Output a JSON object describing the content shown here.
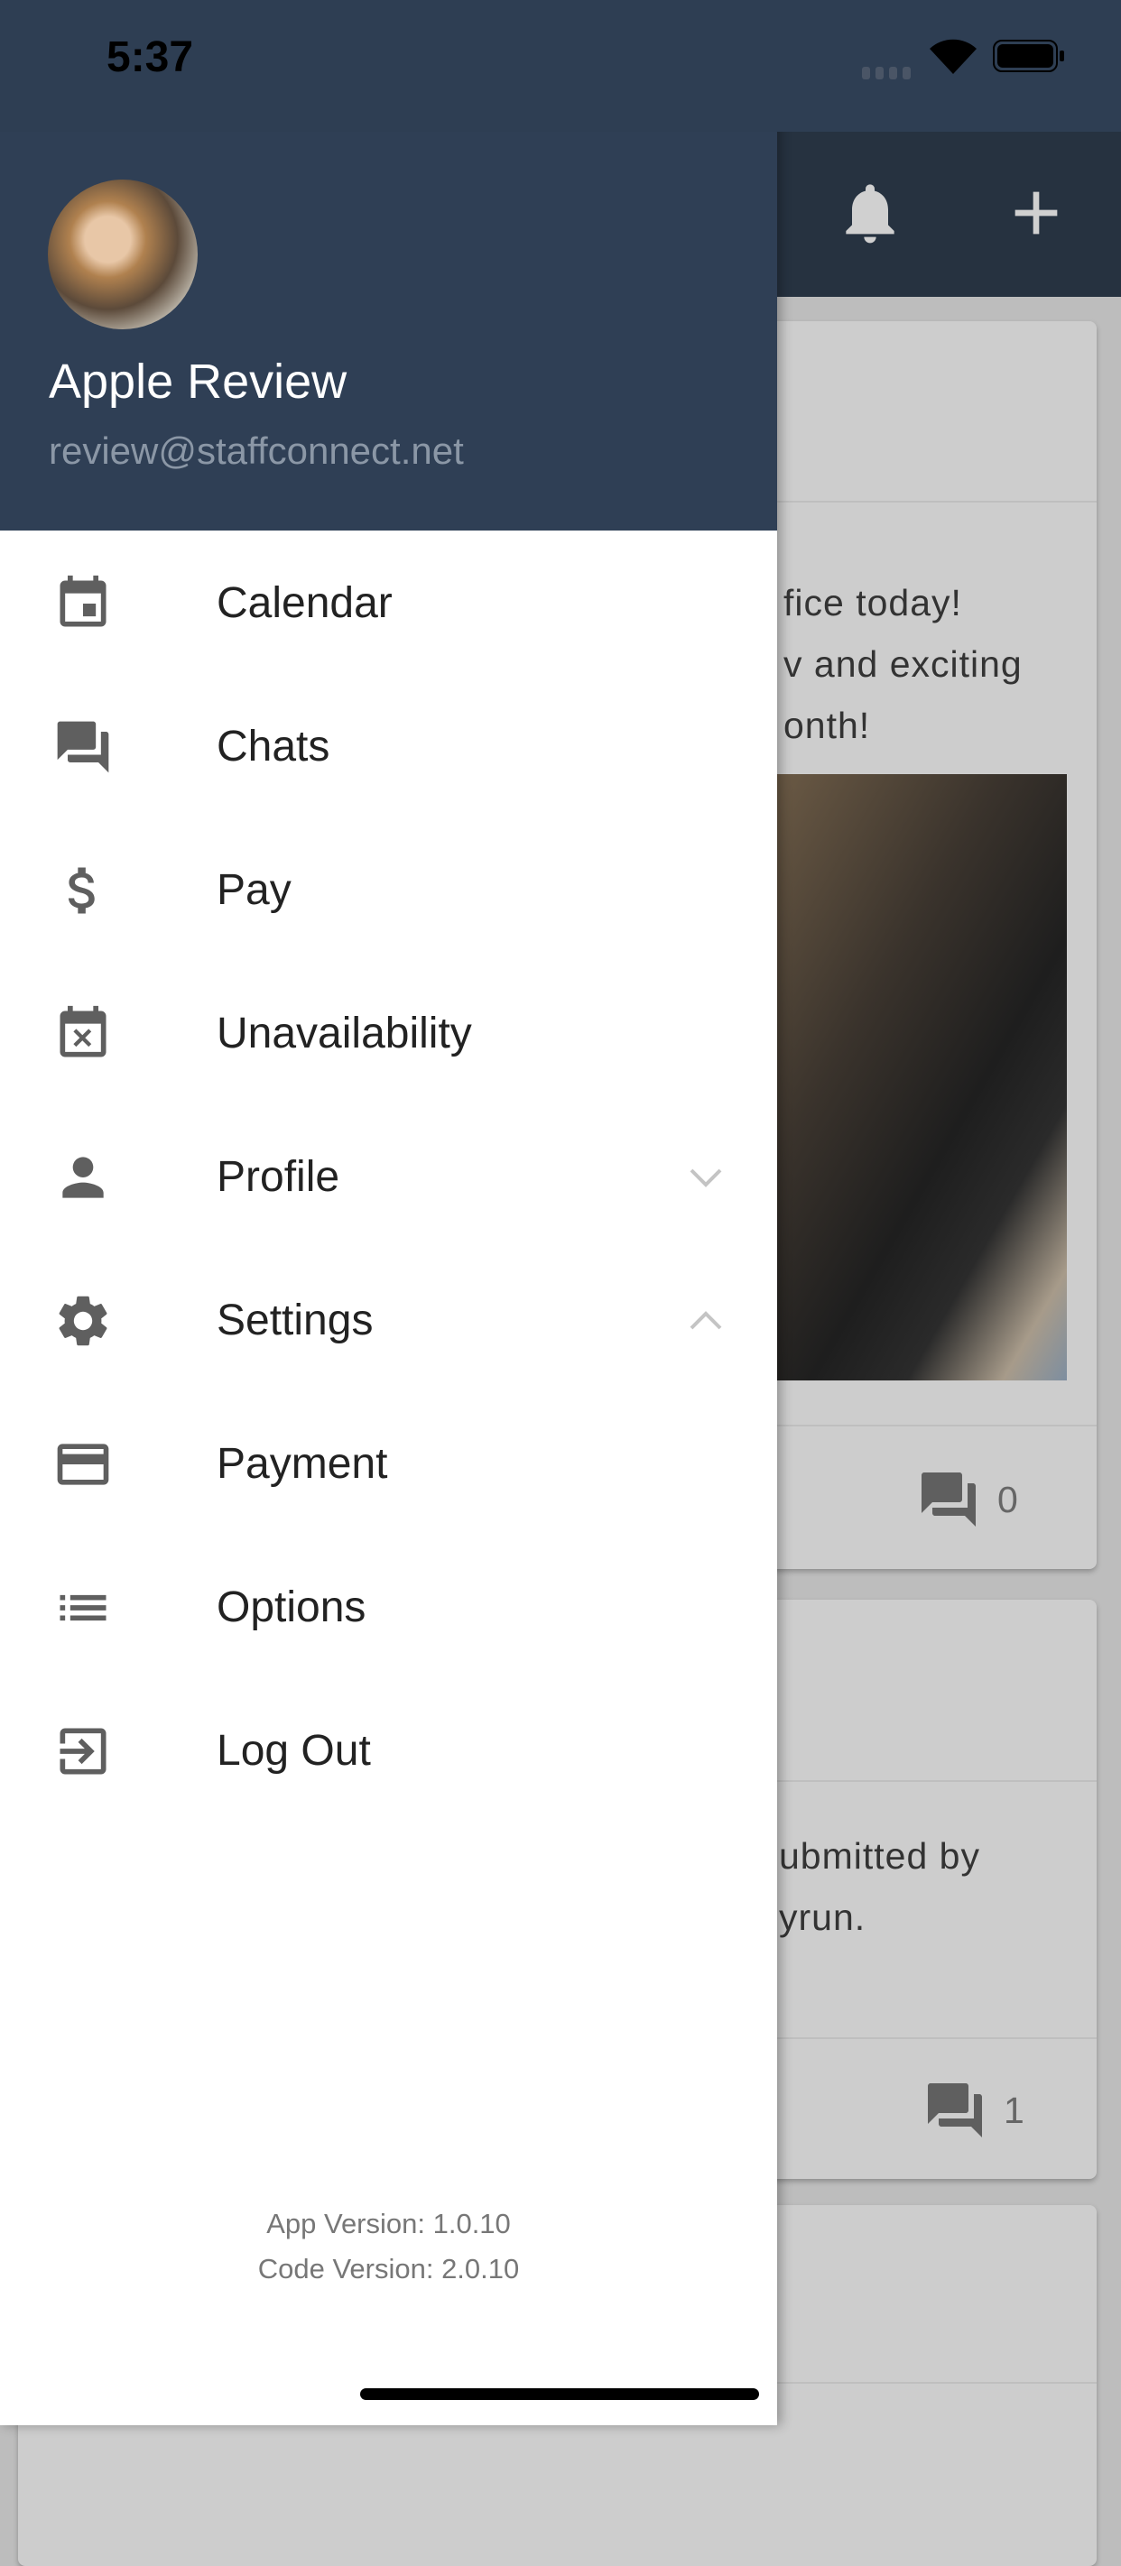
{
  "status_bar": {
    "time": "5:37"
  },
  "app_bar": {
    "icons": [
      "bell-icon",
      "plus-icon"
    ]
  },
  "feed": {
    "cards": [
      {
        "text_lines": [
          "fice today!",
          "v and exciting",
          "onth!"
        ],
        "comment_count": "0"
      },
      {
        "text_lines": [
          "ubmitted by",
          "yrun."
        ],
        "comment_count": "1"
      }
    ]
  },
  "drawer": {
    "user": {
      "name": "Apple Review",
      "email": "review@staffconnect.net"
    },
    "items": [
      {
        "label": "Calendar",
        "icon": "calendar-icon"
      },
      {
        "label": "Chats",
        "icon": "chat-icon"
      },
      {
        "label": "Pay",
        "icon": "dollar-icon"
      },
      {
        "label": "Unavailability",
        "icon": "calendar-x-icon"
      },
      {
        "label": "Profile",
        "icon": "person-icon",
        "chevron": "down"
      },
      {
        "label": "Settings",
        "icon": "gear-icon",
        "chevron": "up"
      },
      {
        "label": "Payment",
        "icon": "credit-card-icon"
      },
      {
        "label": "Options",
        "icon": "list-icon"
      },
      {
        "label": "Log Out",
        "icon": "logout-icon"
      }
    ],
    "app_version": "App Version: 1.0.10",
    "code_version": "Code Version: 2.0.10"
  },
  "colors": {
    "header": "#2f3f55",
    "appbar": "#263240",
    "icon": "#5f5f5f"
  }
}
